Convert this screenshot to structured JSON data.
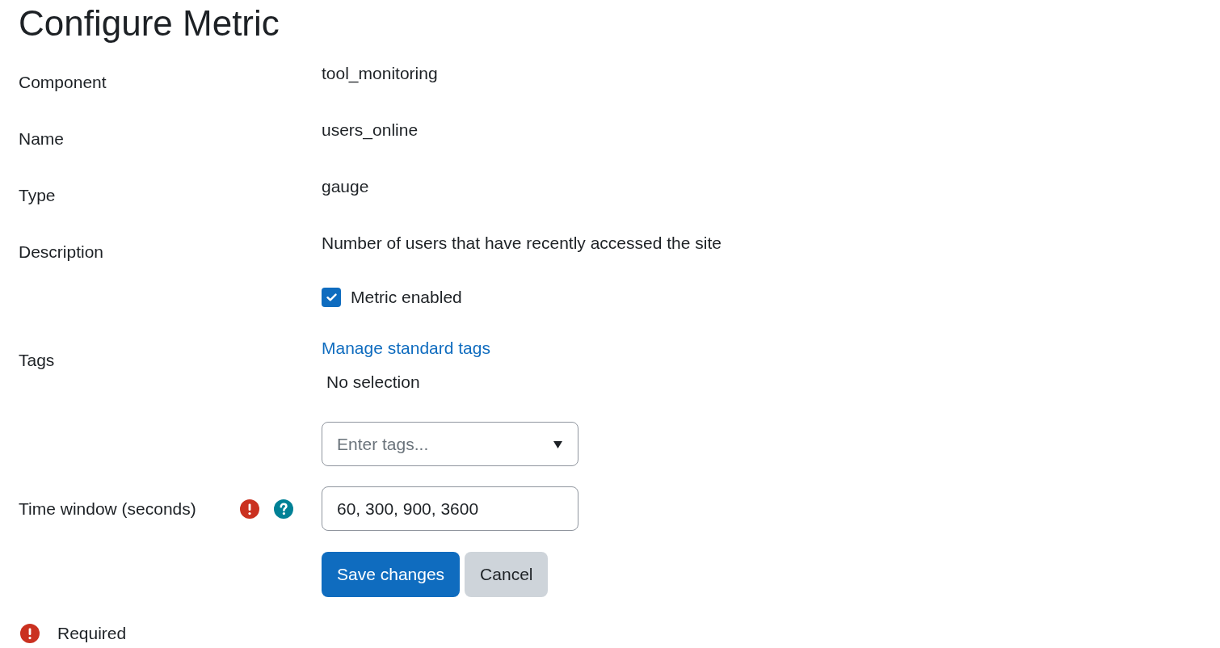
{
  "page_title": "Configure Metric",
  "fields": [
    {
      "kind": "static",
      "label": "Component",
      "value": "tool_monitoring"
    },
    {
      "kind": "static",
      "label": "Name",
      "value": "users_online"
    },
    {
      "kind": "static",
      "label": "Type",
      "value": "gauge"
    },
    {
      "kind": "static",
      "label": "Description",
      "value": "Number of users that have recently accessed the site"
    },
    {
      "kind": "checkbox",
      "label": "Metric enabled",
      "checked": true
    },
    {
      "kind": "tags",
      "label": "Tags",
      "link": "Manage standard tags",
      "selection": "No selection",
      "placeholder": "Enter tags..."
    },
    {
      "kind": "text",
      "label": "Time window (seconds)",
      "required": true,
      "help": true,
      "value": "60, 300, 900, 3600"
    }
  ],
  "buttons": [
    {
      "kind": "primary",
      "label": "Save changes"
    },
    {
      "kind": "secondary",
      "label": "Cancel"
    }
  ],
  "required_note": "Required"
}
